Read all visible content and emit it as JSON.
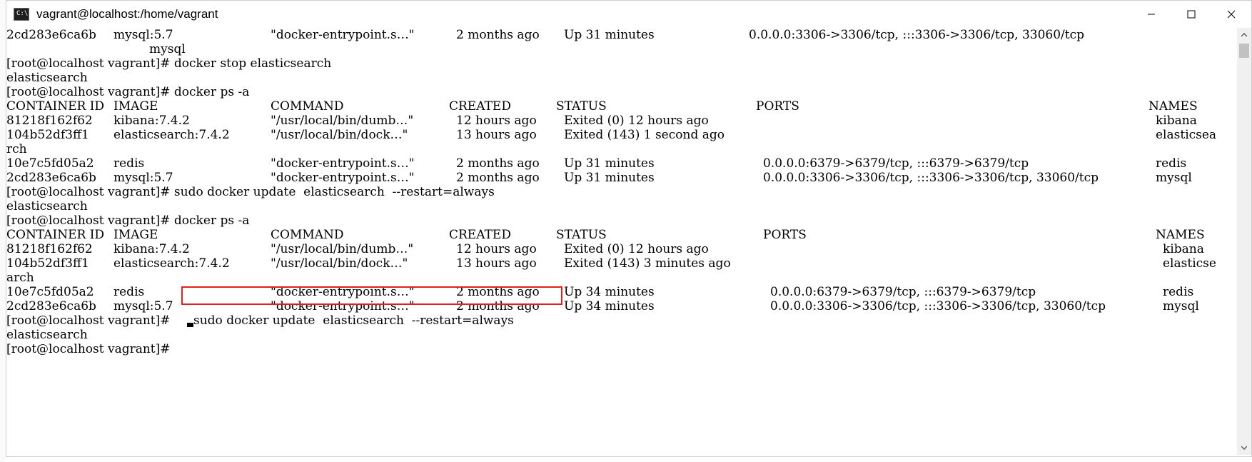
{
  "window": {
    "title": "vagrant@localhost:/home/vagrant",
    "icon_label": "C:\\",
    "controls": [
      "minimize-icon",
      "maximize-icon",
      "close-icon"
    ]
  },
  "terminal": {
    "l1": {
      "a": "2cd283e6ca6b",
      "b": "mysql:5.7",
      "c": "\"docker-entrypoint.s…\"",
      "d": "2 months ago",
      "e": "Up 31 minutes",
      "f": "0.0.0.0:3306->3306/tcp, :::3306->3306/tcp, 33060/tcp"
    },
    "l2": {
      "a": "mysql"
    },
    "l3": {
      "a": "[root@localhost vagrant]# docker stop elasticsearch"
    },
    "l4": {
      "a": "elasticsearch"
    },
    "l5": {
      "a": "[root@localhost vagrant]# docker ps -a"
    },
    "l6": {
      "a": "CONTAINER ID",
      "b": "IMAGE",
      "c": "COMMAND",
      "d": "CREATED",
      "e": "STATUS",
      "f": "PORTS",
      "g": "NAMES"
    },
    "l7": {
      "a": "81218f162f62",
      "b": "kibana:7.4.2",
      "c": "\"/usr/local/bin/dumb…\"",
      "d": "12 hours ago",
      "e": "Exited (0) 12 hours ago",
      "g": "kibana"
    },
    "l8": {
      "a": "104b52df3ff1",
      "b": "elasticsearch:7.4.2",
      "c": "\"/usr/local/bin/dock…\"",
      "d": "13 hours ago",
      "e": "Exited (143) 1 second ago",
      "g": "elasticsea"
    },
    "l9": {
      "a": "rch"
    },
    "l10": {
      "a": "10e7c5fd05a2",
      "b": "redis",
      "c": "\"docker-entrypoint.s…\"",
      "d": "2 months ago",
      "e": "Up 31 minutes",
      "f": "0.0.0.0:6379->6379/tcp, :::6379->6379/tcp",
      "g": "redis"
    },
    "l11": {
      "a": "2cd283e6ca6b",
      "b": "mysql:5.7",
      "c": "\"docker-entrypoint.s…\"",
      "d": "2 months ago",
      "e": "Up 31 minutes",
      "f": "0.0.0.0:3306->3306/tcp, :::3306->3306/tcp, 33060/tcp",
      "g": "mysql"
    },
    "l12": {
      "a": "[root@localhost vagrant]# sudo docker update  elasticsearch  --restart=always"
    },
    "l13": {
      "a": "elasticsearch"
    },
    "l14": {
      "a": "[root@localhost vagrant]# docker ps -a"
    },
    "l15": {
      "a": "CONTAINER ID",
      "b": "IMAGE",
      "c": "COMMAND",
      "d": "CREATED",
      "e": "STATUS",
      "f": "PORTS",
      "g": "NAMES"
    },
    "l16": {
      "a": "81218f162f62",
      "b": "kibana:7.4.2",
      "c": "\"/usr/local/bin/dumb…\"",
      "d": "12 hours ago",
      "e": "Exited (0) 12 hours ago",
      "g": "kibana"
    },
    "l17": {
      "a": "104b52df3ff1",
      "b": "elasticsearch:7.4.2",
      "c": "\"/usr/local/bin/dock…\"",
      "d": "13 hours ago",
      "e": "Exited (143) 3 minutes ago",
      "g": "elasticse"
    },
    "l18": {
      "a": "arch"
    },
    "l19": {
      "a": "10e7c5fd05a2",
      "b": "redis",
      "c": "\"docker-entrypoint.s…\"",
      "d": "2 months ago",
      "e": "Up 34 minutes",
      "f": "0.0.0.0:6379->6379/tcp, :::6379->6379/tcp",
      "g": "redis"
    },
    "l20": {
      "a": "2cd283e6ca6b",
      "b": "mysql:5.7",
      "c": "\"docker-entrypoint.s…\"",
      "d": "2 months ago",
      "e": "Up 34 minutes",
      "f": "0.0.0.0:3306->3306/tcp, :::3306->3306/tcp, 33060/tcp",
      "g": "mysql"
    },
    "l21": {
      "prompt": "[root@localhost vagrant]#",
      "cmd": "sudo docker update  elasticsearch  --restart=always"
    },
    "l22": {
      "a": "elasticsearch"
    },
    "l23": {
      "prompt": "[root@localhost vagrant]#"
    }
  },
  "colors": {
    "highlight": "#e02020",
    "text": "#000000",
    "background": "#ffffff"
  }
}
